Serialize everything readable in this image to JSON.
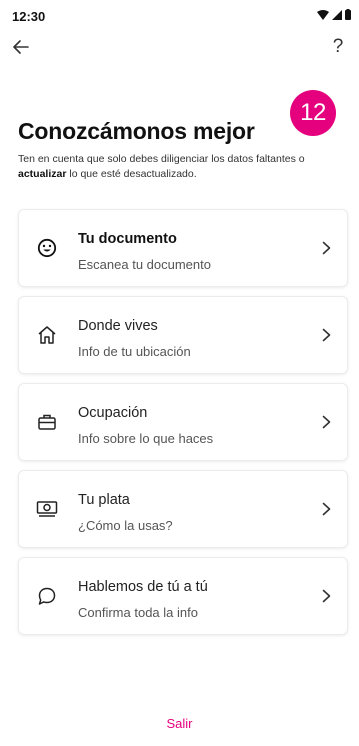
{
  "status_bar": {
    "time": "12:30"
  },
  "nav": {
    "help_label": "?"
  },
  "step": {
    "number": "12"
  },
  "header": {
    "title": "Conozcámonos mejor",
    "subtitle_before": "Ten en cuenta que solo debes diligenciar los datos faltantes o ",
    "subtitle_bold": "actualizar",
    "subtitle_after": " lo que esté desactualizado."
  },
  "cards": [
    {
      "icon": "face-icon",
      "title": "Tu documento",
      "subtitle": "Escanea tu documento"
    },
    {
      "icon": "home-icon",
      "title": "Donde vives",
      "subtitle": "Info de tu ubicación"
    },
    {
      "icon": "briefcase-icon",
      "title": "Ocupación",
      "subtitle": "Info sobre lo que haces"
    },
    {
      "icon": "money-icon",
      "title": "Tu plata",
      "subtitle": "¿Cómo la usas?"
    },
    {
      "icon": "chat-icon",
      "title": "Hablemos de tú a tú",
      "subtitle": "Confirma toda la info"
    }
  ],
  "footer": {
    "exit_label": "Salir"
  },
  "colors": {
    "accent": "#e5007e",
    "text": "#111111"
  }
}
